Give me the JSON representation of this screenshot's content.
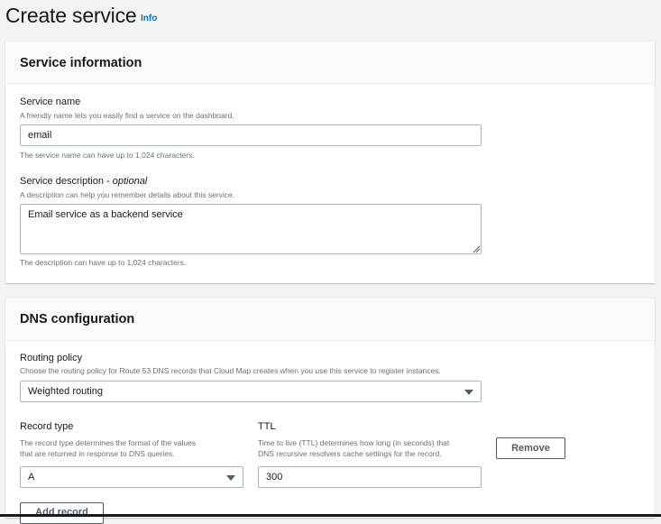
{
  "page": {
    "title": "Create service",
    "info_label": "Info"
  },
  "service_info": {
    "title": "Service information",
    "name": {
      "label": "Service name",
      "description": "A friendly name lets you easily find a service on the dashboard.",
      "value": "email",
      "hint": "The service name can have up to 1,024 characters."
    },
    "description": {
      "label": "Service description -",
      "optional": "optional",
      "description": "A description can help you remember details about this service.",
      "value": "Email service as a backend service",
      "hint": "The description can have up to 1,024 characters."
    }
  },
  "dns": {
    "title": "DNS configuration",
    "routing": {
      "label": "Routing policy",
      "description": "Choose the routing policy for Route 53 DNS records that Cloud Map creates when you use this service to register instances.",
      "value": "Weighted routing"
    },
    "record_type": {
      "label": "Record type",
      "description_line1": "The record type determines the format of the values",
      "description_line2": "that are returned in response to DNS queries.",
      "value": "A"
    },
    "ttl": {
      "label": "TTL",
      "description_line1": "Time to live (TTL) determines how long (in seconds) that",
      "description_line2": "DNS recursive resolvers cache settings for the record.",
      "value": "300"
    },
    "remove_label": "Remove",
    "add_record_label": "Add record"
  }
}
